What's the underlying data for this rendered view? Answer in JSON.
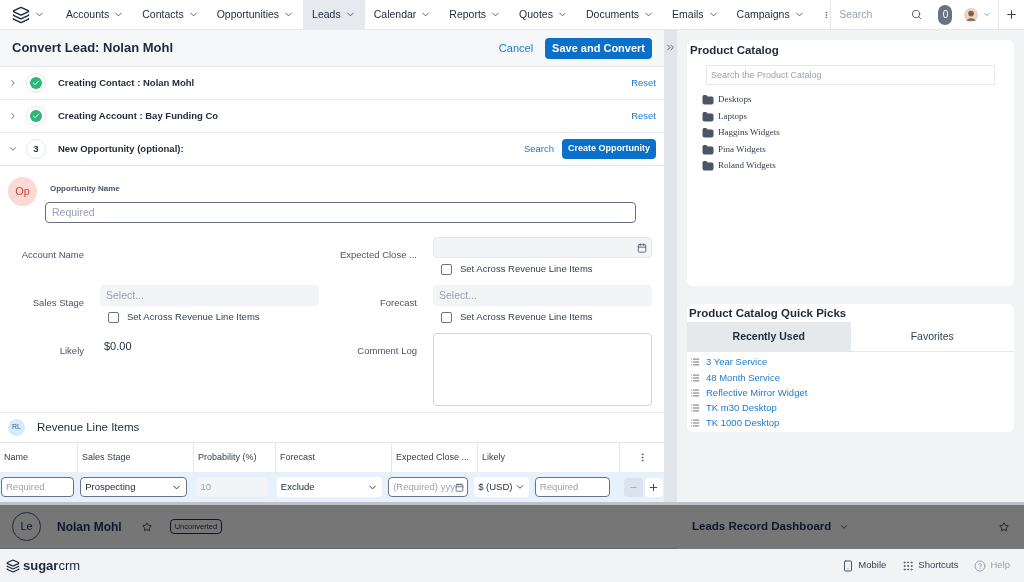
{
  "nav": {
    "items": [
      {
        "label": "Accounts",
        "selected": false
      },
      {
        "label": "Contacts",
        "selected": false
      },
      {
        "label": "Opportunities",
        "selected": false
      },
      {
        "label": "Leads",
        "selected": true
      },
      {
        "label": "Calendar",
        "selected": false
      },
      {
        "label": "Reports",
        "selected": false
      },
      {
        "label": "Quotes",
        "selected": false
      },
      {
        "label": "Documents",
        "selected": false
      },
      {
        "label": "Emails",
        "selected": false
      },
      {
        "label": "Campaigns",
        "selected": false
      }
    ],
    "search_placeholder": "Search",
    "notifications": "0"
  },
  "convert": {
    "title": "Convert Lead: Nolan Mohl",
    "cancel": "Cancel",
    "save": "Save and Convert",
    "steps": [
      {
        "title": "Creating Contact : Nolan Mohl",
        "done": true,
        "expanded": false,
        "actions": [
          {
            "label": "Reset",
            "kind": "link"
          }
        ]
      },
      {
        "title": "Creating Account : Bay Funding Co",
        "done": true,
        "expanded": false,
        "actions": [
          {
            "label": "Reset",
            "kind": "link"
          }
        ]
      },
      {
        "number": "3",
        "title": "New Opportunity (optional):",
        "done": false,
        "expanded": true,
        "actions": [
          {
            "label": "Search",
            "kind": "link"
          },
          {
            "label": "Create Opportunity",
            "kind": "button"
          }
        ]
      }
    ]
  },
  "opportunity": {
    "avatar": "Op",
    "name_label": "Opportunity Name",
    "name_placeholder": "Required",
    "rows": [
      {
        "left": {
          "label": "Account Name",
          "kind": "empty"
        },
        "right": {
          "label": "Expected Close ...",
          "kind": "date",
          "checkbox": {
            "label": "Set Across Revenue Line Items",
            "checked": false
          }
        }
      },
      {
        "left": {
          "label": "Sales Stage",
          "kind": "select",
          "placeholder": "Select...",
          "checkbox": {
            "label": "Set Across Revenue Line Items",
            "checked": false
          }
        },
        "right": {
          "label": "Forecast",
          "kind": "select",
          "placeholder": "Select...",
          "checkbox": {
            "label": "Set Across Revenue Line Items",
            "checked": false
          }
        }
      },
      {
        "left": {
          "label": "Likely",
          "kind": "value",
          "value": "$0.00"
        },
        "right": {
          "label": "Comment Log",
          "kind": "textarea"
        }
      }
    ]
  },
  "revenue_line_items": {
    "avatar": "RL",
    "title": "Revenue Line Items",
    "columns": [
      "Name",
      "Sales Stage",
      "Probability (%)",
      "Forecast",
      "Expected Close ...",
      "Likely"
    ],
    "row": {
      "name_placeholder": "Required",
      "sales_stage": "Prospecting",
      "probability": "10",
      "forecast": "Exclude",
      "expected_close_placeholder": "(Required) yyy",
      "currency": "$ (USD)",
      "likely_placeholder": "Required"
    }
  },
  "product_catalog": {
    "title": "Product Catalog",
    "search_placeholder": "Search the Product Catalog",
    "folders": [
      "Desktops",
      "Laptops",
      "Haggins Widgets",
      "Pina Widgets",
      "Roland Widgets"
    ]
  },
  "quick_picks": {
    "title": "Product Catalog Quick Picks",
    "tabs": [
      {
        "label": "Recently Used",
        "selected": true
      },
      {
        "label": "Favorites",
        "selected": false
      }
    ],
    "items": [
      "3 Year Service",
      "48 Month Service",
      "Reflective Mirror Widget",
      "TK m30 Desktop",
      "TK 1000 Desktop"
    ]
  },
  "record": {
    "avatar": "Le",
    "name": "Nolan Mohl",
    "status": "Unconverted"
  },
  "dashboard": {
    "title": "Leads Record Dashboard"
  },
  "footer": {
    "logo": "**sugar**crm",
    "links": [
      {
        "label": "Mobile",
        "kind": "mobile"
      },
      {
        "label": "Shortcuts",
        "kind": "shortcuts"
      },
      {
        "label": "Help",
        "kind": "help"
      }
    ]
  }
}
